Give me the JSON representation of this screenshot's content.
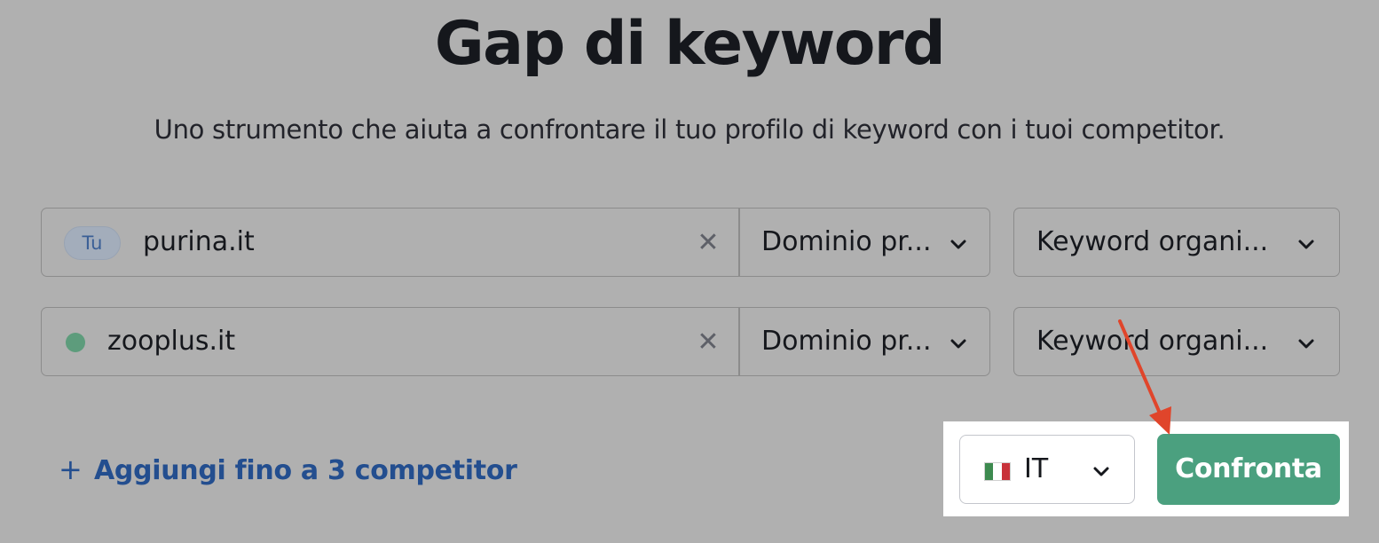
{
  "page": {
    "title": "Gap di keyword",
    "subtitle": "Uno strumento che aiuta a confrontare il tuo profilo di keyword con i tuoi competitor."
  },
  "rows": [
    {
      "badge": "Tu",
      "domain": "purina.it",
      "domain_type": "Dominio pr...",
      "keyword_type": "Keyword organi..."
    },
    {
      "marker_color": "#5d9c7c",
      "domain": "zooplus.it",
      "domain_type": "Dominio pr...",
      "keyword_type": "Keyword organi..."
    }
  ],
  "add_competitor": {
    "icon": "plus-icon",
    "label": "Aggiungi fino a 3 competitor"
  },
  "country_select": {
    "flag": "italy-flag-icon",
    "value": "IT"
  },
  "compare_button": {
    "label": "Confronta",
    "color": "#4ba07f"
  },
  "annotation": {
    "arrow_color": "#e0452b",
    "highlight_color": "#ffffff"
  }
}
